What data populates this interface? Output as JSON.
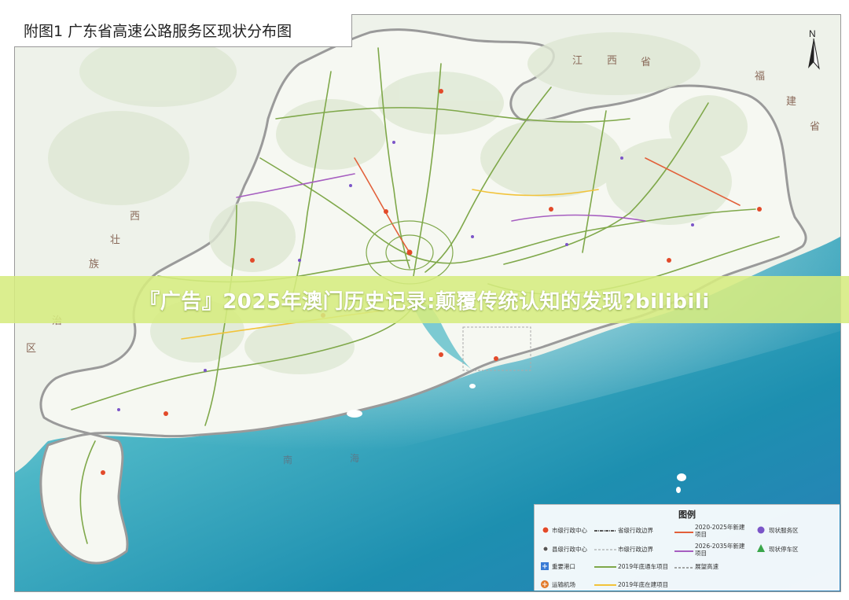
{
  "map": {
    "title": "附图1  广东省高速公路服务区现状分布图",
    "north_label": "N",
    "region_labels": {
      "jiangxi": [
        "江",
        "西",
        "省"
      ],
      "fujian": [
        "福",
        "建",
        "省"
      ],
      "guangxi": [
        "西",
        "壮",
        "族",
        "治",
        "区"
      ],
      "sea": [
        "南",
        "海"
      ]
    }
  },
  "banner": {
    "text": "『广告』2025年澳门历史记录:颠覆传统认知的发现?bilibili"
  },
  "legend": {
    "title": "图例",
    "items": {
      "city_center": "市级行政中心",
      "county_center": "县级行政中心",
      "port": "重要港口",
      "airport": "运输机场",
      "prov_boundary": "省级行政边界",
      "city_boundary": "市级行政边界",
      "built_2019": "2019年底通车项目",
      "building_2019": "2019年底在建项目",
      "new_2020_2025": "2020-2025年新建项目",
      "new_2026_2035": "2026-2035年新建项目",
      "planned": "展望高速",
      "service_area": "现状服务区",
      "parking_area": "现状停车区"
    },
    "colors": {
      "built_2019": "#7fa84a",
      "building_2019": "#f2c33a",
      "new_2020_2025": "#e2603a",
      "new_2026_2035": "#a65ec0",
      "service_area": "#7b55c8",
      "parking_area": "#3aa64a",
      "city_center": "#e24a2a"
    }
  }
}
